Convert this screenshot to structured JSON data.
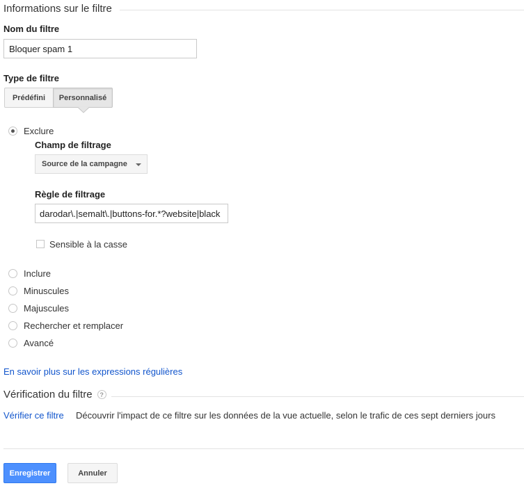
{
  "filter_info": {
    "section_title": "Informations sur le filtre",
    "name_label": "Nom du filtre",
    "name_value": "Bloquer spam 1",
    "type_label": "Type de filtre",
    "type_tabs": [
      {
        "label": "Prédéfini",
        "selected": false
      },
      {
        "label": "Personnalisé",
        "selected": true
      }
    ]
  },
  "custom_options": [
    {
      "label": "Exclure",
      "selected": true
    },
    {
      "label": "Inclure",
      "selected": false
    },
    {
      "label": "Minuscules",
      "selected": false
    },
    {
      "label": "Majuscules",
      "selected": false
    },
    {
      "label": "Rechercher et remplacer",
      "selected": false
    },
    {
      "label": "Avancé",
      "selected": false
    }
  ],
  "exclude": {
    "field_label": "Champ de filtrage",
    "field_value": "Source de la campagne",
    "pattern_label": "Règle de filtrage",
    "pattern_value": "darodar\\.|semalt\\.|buttons-for.*?website|black",
    "case_sensitive_label": "Sensible à la casse",
    "case_sensitive": false
  },
  "regex_link": "En savoir plus sur les expressions régulières",
  "verification": {
    "section_title": "Vérification du filtre",
    "help_glyph": "?",
    "verify_link": "Vérifier ce filtre",
    "description": "Découvrir l'impact de ce filtre sur les données de la vue actuelle, selon le trafic de ces sept derniers jours"
  },
  "actions": {
    "save_label": "Enregistrer",
    "cancel_label": "Annuler"
  },
  "colors": {
    "link": "#1155cc",
    "primary_button": "#4d90fe"
  },
  "icons": {
    "help": "help-circle-icon",
    "dropdown": "caret-down-icon"
  }
}
